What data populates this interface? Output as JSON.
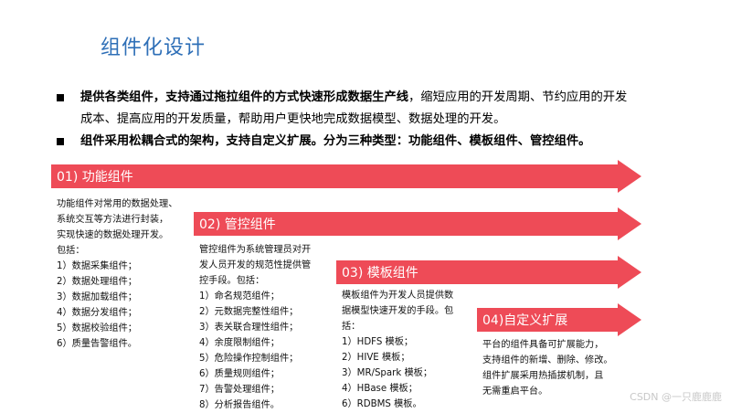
{
  "title": "组件化设计",
  "bullets": [
    {
      "bold": "提供各类组件，支持通过拖拉组件的方式快速形成数据生产线",
      "normal": "，缩短应用的开发周期、节约应用的开发",
      "line2": "成本、提高应用的开发质量，帮助用户更快地完成数据模型、数据处理的开发。"
    },
    {
      "bold": "组件采用松耦合式的架构，支持自定义扩展。分为三种类型：功能组件、模板组件、管控组件。"
    }
  ],
  "arrows": [
    {
      "label": "01) 功能组件"
    },
    {
      "label": "02) 管控组件"
    },
    {
      "label": "03) 模板组件"
    },
    {
      "label": "04)自定义扩展"
    }
  ],
  "descriptions": [
    [
      "功能组件对常用的数据处理、",
      "系统交互等方法进行封装，",
      "实现快速的数据处理开发。",
      "包括：",
      "1）数据采集组件；",
      "2）数据处理组件；",
      "3）数据加载组件；",
      "4）数据分发组件；",
      "5）数据校验组件；",
      "6）质量告警组件。"
    ],
    [
      "管控组件为系统管理员对开",
      "发人员开发的规范性提供管",
      "控手段。包括：",
      "1）命名规范组件；",
      "2）元数据完整性组件；",
      "3）表关联合理性组件；",
      "4）余度限制组件；",
      "5）危险操作控制组件；",
      "6）质量规则组件；",
      "7）告警处理组件；",
      "8）分析报告组件。"
    ],
    [
      "模板组件为开发人员提供数",
      "据模型快速开发的手段。包",
      "括：",
      "1）HDFS 模板；",
      "2）HIVE 模板；",
      "3）MR/Spark 模板；",
      "4）HBase 模板；",
      "6）RDBMS 模板。"
    ],
    [
      "平台的组件具备可扩展能力，",
      "支持组件的新增、删除、修改。",
      "组件扩展采用热插拔机制，且",
      "无需重启平台。"
    ]
  ],
  "watermark": "CSDN @一只鹿鹿鹿",
  "colors": {
    "title": "#2e6fb7",
    "arrow": "#ee4b57"
  }
}
